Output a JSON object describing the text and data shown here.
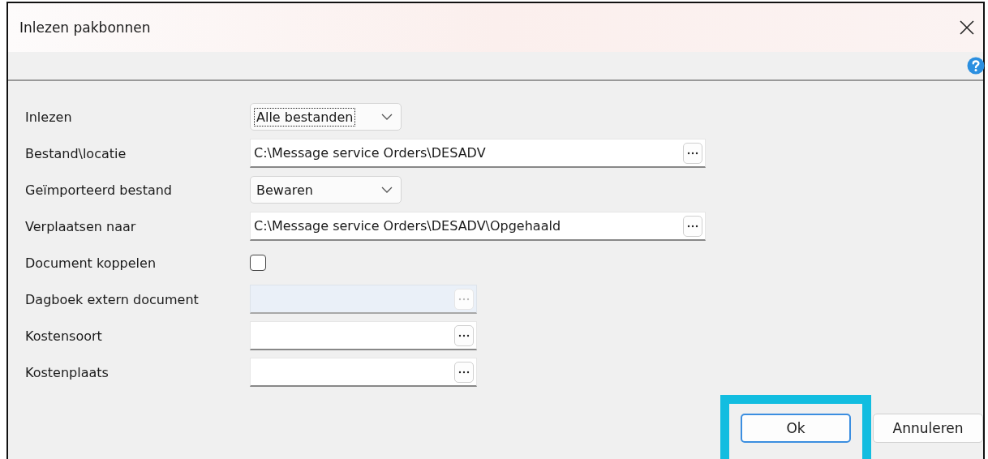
{
  "window": {
    "title": "Inlezen pakbonnen"
  },
  "fields": [
    {
      "kind": "dropdown",
      "label": "Inlezen",
      "value": "Alle bestanden",
      "focused": true
    },
    {
      "kind": "path",
      "label": "Bestand\\locatie",
      "value": "C:\\Message service Orders\\DESADV"
    },
    {
      "kind": "dropdown",
      "label": "Geïmporteerd bestand",
      "value": "Bewaren",
      "focused": false
    },
    {
      "kind": "path",
      "label": "Verplaatsen naar",
      "value": "C:\\Message service Orders\\DESADV\\Opgehaald"
    },
    {
      "kind": "checkbox",
      "label": "Document koppelen",
      "checked": false
    },
    {
      "kind": "lookup",
      "label": "Dagboek extern document",
      "disabled": true
    },
    {
      "kind": "lookup",
      "label": "Kostensoort",
      "disabled": false
    },
    {
      "kind": "lookup",
      "label": "Kostenplaats",
      "disabled": false
    }
  ],
  "buttons": [
    {
      "label": "Ok",
      "default": true,
      "highlighted": true
    },
    {
      "label": "Annuleren",
      "default": false,
      "highlighted": false
    }
  ]
}
